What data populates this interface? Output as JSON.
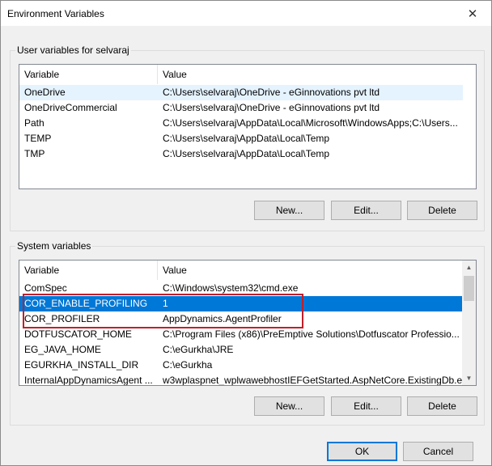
{
  "window": {
    "title": "Environment Variables"
  },
  "icons": {
    "close": "close-icon",
    "scroll_up": "chevron-up-icon",
    "scroll_down": "chevron-down-icon"
  },
  "colors": {
    "selection": "#0078d7",
    "highlight_box": "#c0202a",
    "hover": "#e5f3ff"
  },
  "user_section": {
    "legend": "User variables for selvaraj",
    "columns": [
      "Variable",
      "Value"
    ],
    "rows": [
      {
        "variable": "OneDrive",
        "value": "C:\\Users\\selvaraj\\OneDrive - eGinnovations pvt ltd",
        "state": "hover"
      },
      {
        "variable": "OneDriveCommercial",
        "value": "C:\\Users\\selvaraj\\OneDrive - eGinnovations pvt ltd",
        "state": ""
      },
      {
        "variable": "Path",
        "value": "C:\\Users\\selvaraj\\AppData\\Local\\Microsoft\\WindowsApps;C:\\Users...",
        "state": ""
      },
      {
        "variable": "TEMP",
        "value": "C:\\Users\\selvaraj\\AppData\\Local\\Temp",
        "state": ""
      },
      {
        "variable": "TMP",
        "value": "C:\\Users\\selvaraj\\AppData\\Local\\Temp",
        "state": ""
      }
    ],
    "buttons": {
      "new": "New...",
      "edit": "Edit...",
      "delete": "Delete"
    }
  },
  "system_section": {
    "legend": "System variables",
    "columns": [
      "Variable",
      "Value"
    ],
    "rows": [
      {
        "variable": "ComSpec",
        "value": "C:\\Windows\\system32\\cmd.exe",
        "state": ""
      },
      {
        "variable": "COR_ENABLE_PROFILING",
        "value": "1",
        "state": "selected"
      },
      {
        "variable": "COR_PROFILER",
        "value": "AppDynamics.AgentProfiler",
        "state": ""
      },
      {
        "variable": "DOTFUSCATOR_HOME",
        "value": "C:\\Program Files (x86)\\PreEmptive Solutions\\Dotfuscator Professio...",
        "state": ""
      },
      {
        "variable": "EG_JAVA_HOME",
        "value": "C:\\eGurkha\\JRE",
        "state": ""
      },
      {
        "variable": "EGURKHA_INSTALL_DIR",
        "value": "C:\\eGurkha",
        "state": ""
      },
      {
        "variable": "InternalAppDynamicsAgent ...",
        "value": "w3wplaspnet_wplwawebhostIEFGetStarted.AspNetCore.ExistingDb.e...",
        "state": ""
      }
    ],
    "buttons": {
      "new": "New...",
      "edit": "Edit...",
      "delete": "Delete"
    }
  },
  "footer": {
    "ok": "OK",
    "cancel": "Cancel"
  }
}
